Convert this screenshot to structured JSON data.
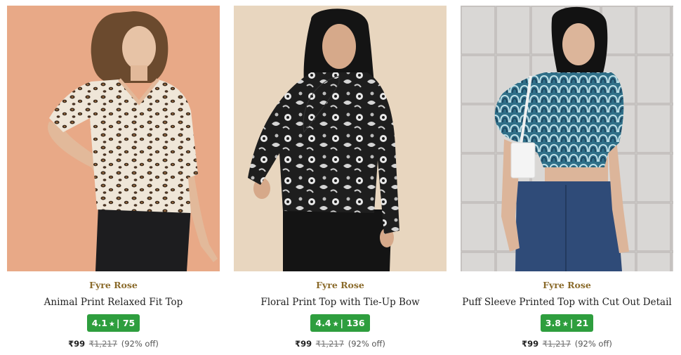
{
  "products": [
    {
      "brand": "Fyre Rose",
      "title": "Animal Print Relaxed Fit Top",
      "rating": "4.1",
      "reviews": "75",
      "price": "₹99",
      "mrp": "₹1,217",
      "discount": "(92% off)",
      "image_icon": "model-leopard-top-photo"
    },
    {
      "brand": "Fyre Rose",
      "title": "Floral Print Top with Tie-Up Bow",
      "rating": "4.4",
      "reviews": "136",
      "price": "₹99",
      "mrp": "₹1,217",
      "discount": "(92% off)",
      "image_icon": "model-floral-top-photo"
    },
    {
      "brand": "Fyre Rose",
      "title": "Puff Sleeve Printed Top with Cut Out Detail",
      "rating": "3.8",
      "reviews": "21",
      "price": "₹99",
      "mrp": "₹1,217",
      "discount": "(92% off)",
      "image_icon": "model-puff-sleeve-top-photo"
    }
  ],
  "colors": {
    "brand_text": "#8a6a2a",
    "rating_badge": "#2e9e3e",
    "photo1_bg": "#e8a987",
    "photo2_bg": "#e8d6bf",
    "photo3_bg": "#d9d7d5"
  }
}
